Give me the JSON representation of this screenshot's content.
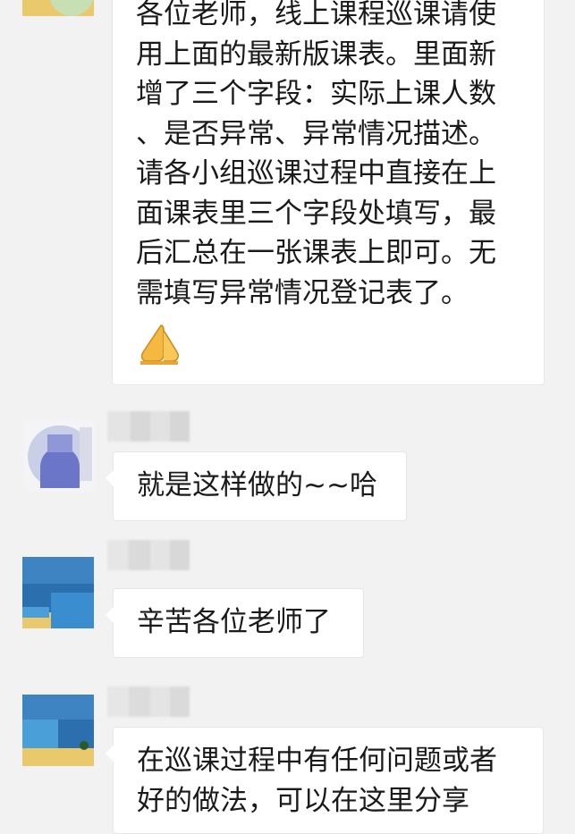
{
  "chat": {
    "messages": [
      {
        "text": "各位老师，线上课程巡课请使\n用上面的最新版课表。里面新\n增了三个字段：实际上课人数\n、是否异常、异常情况描述。\n请各小组巡课过程中直接在上\n面课表里三个字段处填写，最\n后汇总在一张课表上即可。无\n需填写异常情况登记表了。",
        "emoji": "folded-hands-emoji"
      },
      {
        "text": "就是这样做的~~哈"
      },
      {
        "text": "辛苦各位老师了"
      },
      {
        "text": "在巡课过程中有任何问题或者\n好的做法，可以在这里分享"
      }
    ]
  },
  "colors": {
    "background": "#f2f2f2",
    "bubble": "#ffffff",
    "text": "#1a1a1a",
    "bubble_border": "#e6e6e6"
  }
}
